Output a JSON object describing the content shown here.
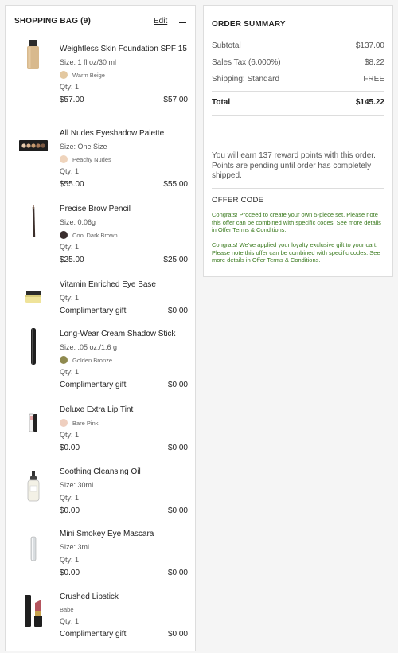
{
  "bag": {
    "title": "SHOPPING BAG (9)",
    "edit_label": "Edit",
    "items": [
      {
        "name": "Weightless Skin Foundation SPF 15",
        "size": "Size: 1 fl oz/30 ml",
        "shade": "Warm Beige",
        "shade_color": "#e3c8a0",
        "qty": "Qty: 1",
        "unit": "$57.00",
        "total": "$57.00"
      },
      {
        "name": "All Nudes Eyeshadow Palette",
        "size": "Size: One Size",
        "shade": "Peachy Nudes",
        "shade_color": "#efd4bc",
        "qty": "Qty: 1",
        "unit": "$55.00",
        "total": "$55.00"
      },
      {
        "name": "Precise Brow Pencil",
        "size": "Size: 0.06g",
        "shade": "Cool Dark Brown",
        "shade_color": "#3a2e2e",
        "qty": "Qty: 1",
        "unit": "$25.00",
        "total": "$25.00"
      },
      {
        "name": "Vitamin Enriched Eye Base",
        "qty": "Qty: 1",
        "unit": "Complimentary gift",
        "total": "$0.00"
      },
      {
        "name": "Long-Wear Cream Shadow Stick",
        "size": "Size: .05 oz./1.6 g",
        "shade": "Golden Bronze",
        "shade_color": "#8f8a4f",
        "qty": "Qty: 1",
        "unit": "Complimentary gift",
        "total": "$0.00"
      },
      {
        "name": "Deluxe Extra Lip Tint",
        "shade": "Bare Pink",
        "shade_color": "#efcfbf",
        "qty": "Qty: 1",
        "unit": "$0.00",
        "total": "$0.00"
      },
      {
        "name": "Soothing Cleansing Oil",
        "size": "Size: 30mL",
        "qty": "Qty: 1",
        "unit": "$0.00",
        "total": "$0.00"
      },
      {
        "name": "Mini Smokey Eye Mascara",
        "size": "Size: 3ml",
        "qty": "Qty: 1",
        "unit": "$0.00",
        "total": "$0.00"
      },
      {
        "name": "Crushed Lipstick",
        "shade": "Babe",
        "qty": "Qty: 1",
        "unit": "Complimentary gift",
        "total": "$0.00"
      }
    ]
  },
  "summary": {
    "title": "ORDER SUMMARY",
    "subtotal_label": "Subtotal",
    "subtotal_value": "$137.00",
    "tax_label": "Sales Tax (6.000%)",
    "tax_value": "$8.22",
    "shipping_label": "Shipping: Standard",
    "shipping_value": "FREE",
    "total_label": "Total",
    "total_value": "$145.22",
    "reward_text": "You will earn 137 reward points with this order. Points are pending until order has completely shipped.",
    "offer_title": "OFFER CODE",
    "offer_msg_1": "Congrats! Proceed to create your own 5-piece set. Please note this offer can be combined with specific codes. See more details in Offer Terms & Conditions.",
    "offer_msg_2": "Congrats! We've applied your loyalty exclusive gift to your cart. Please note this offer can be combined with specific codes. See more details in Offer Terms & Conditions."
  }
}
